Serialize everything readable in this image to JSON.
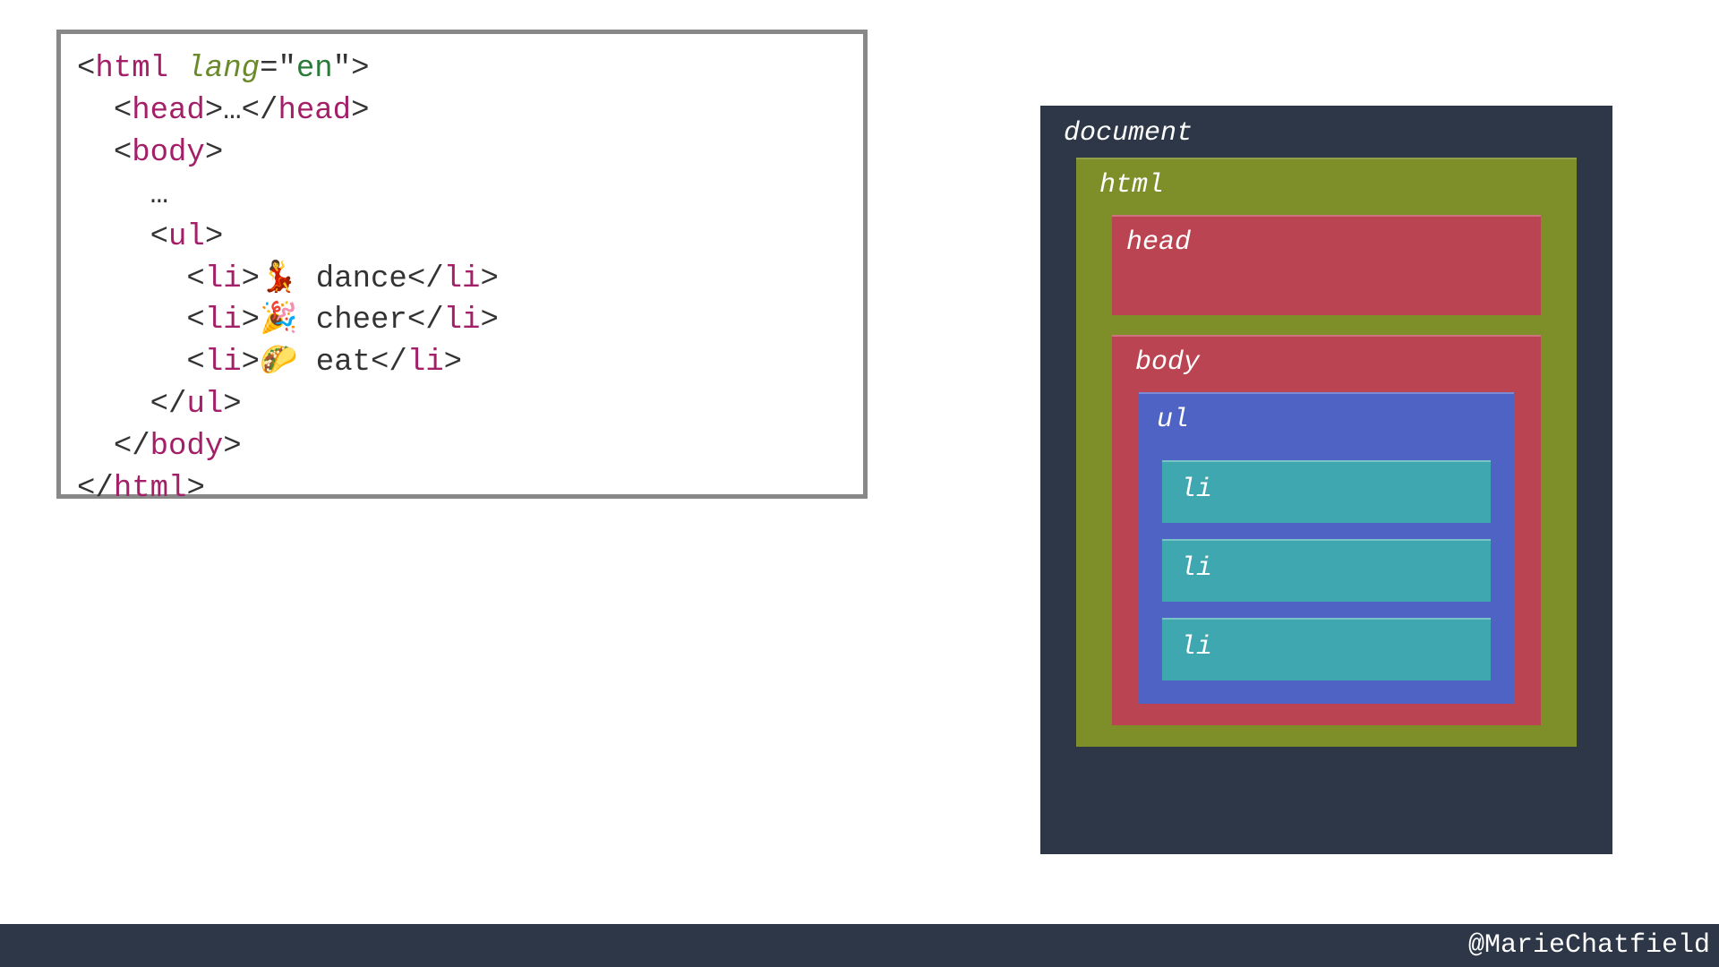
{
  "code": {
    "lines": [
      {
        "indent": 0,
        "parts": [
          {
            "t": "punct",
            "v": "<"
          },
          {
            "t": "tag",
            "v": "html"
          },
          {
            "t": "text",
            "v": " "
          },
          {
            "t": "attr",
            "v": "lang"
          },
          {
            "t": "punct",
            "v": "="
          },
          {
            "t": "punct",
            "v": "\""
          },
          {
            "t": "val",
            "v": "en"
          },
          {
            "t": "punct",
            "v": "\""
          },
          {
            "t": "punct",
            "v": ">"
          }
        ]
      },
      {
        "indent": 1,
        "parts": [
          {
            "t": "punct",
            "v": "<"
          },
          {
            "t": "tag",
            "v": "head"
          },
          {
            "t": "punct",
            "v": ">"
          },
          {
            "t": "text",
            "v": "…"
          },
          {
            "t": "punct",
            "v": "</"
          },
          {
            "t": "tag",
            "v": "head"
          },
          {
            "t": "punct",
            "v": ">"
          }
        ]
      },
      {
        "indent": 1,
        "parts": [
          {
            "t": "punct",
            "v": "<"
          },
          {
            "t": "tag",
            "v": "body"
          },
          {
            "t": "punct",
            "v": ">"
          }
        ]
      },
      {
        "indent": 2,
        "parts": [
          {
            "t": "text",
            "v": "…"
          }
        ]
      },
      {
        "indent": 2,
        "parts": [
          {
            "t": "punct",
            "v": "<"
          },
          {
            "t": "tag",
            "v": "ul"
          },
          {
            "t": "punct",
            "v": ">"
          }
        ]
      },
      {
        "indent": 3,
        "parts": [
          {
            "t": "punct",
            "v": "<"
          },
          {
            "t": "tag",
            "v": "li"
          },
          {
            "t": "punct",
            "v": ">"
          },
          {
            "t": "text",
            "v": "💃 dance"
          },
          {
            "t": "punct",
            "v": "</"
          },
          {
            "t": "tag",
            "v": "li"
          },
          {
            "t": "punct",
            "v": ">"
          }
        ]
      },
      {
        "indent": 3,
        "parts": [
          {
            "t": "punct",
            "v": "<"
          },
          {
            "t": "tag",
            "v": "li"
          },
          {
            "t": "punct",
            "v": ">"
          },
          {
            "t": "text",
            "v": "🎉 cheer"
          },
          {
            "t": "punct",
            "v": "</"
          },
          {
            "t": "tag",
            "v": "li"
          },
          {
            "t": "punct",
            "v": ">"
          }
        ]
      },
      {
        "indent": 3,
        "parts": [
          {
            "t": "punct",
            "v": "<"
          },
          {
            "t": "tag",
            "v": "li"
          },
          {
            "t": "punct",
            "v": ">"
          },
          {
            "t": "text",
            "v": "🌮 eat"
          },
          {
            "t": "punct",
            "v": "</"
          },
          {
            "t": "tag",
            "v": "li"
          },
          {
            "t": "punct",
            "v": ">"
          }
        ]
      },
      {
        "indent": 2,
        "parts": [
          {
            "t": "punct",
            "v": "</"
          },
          {
            "t": "tag",
            "v": "ul"
          },
          {
            "t": "punct",
            "v": ">"
          }
        ]
      },
      {
        "indent": 1,
        "parts": [
          {
            "t": "punct",
            "v": "</"
          },
          {
            "t": "tag",
            "v": "body"
          },
          {
            "t": "punct",
            "v": ">"
          }
        ]
      },
      {
        "indent": 0,
        "parts": [
          {
            "t": "punct",
            "v": "</"
          },
          {
            "t": "tag",
            "v": "html"
          },
          {
            "t": "punct",
            "v": ">"
          }
        ]
      }
    ]
  },
  "dom": {
    "document": "document",
    "html": "html",
    "head": "head",
    "body": "body",
    "ul": "ul",
    "li": [
      "li",
      "li",
      "li"
    ]
  },
  "footer": {
    "handle": "@MarieChatfield"
  },
  "colors": {
    "slide_bg": "#ffffff",
    "code_border": "#888888",
    "tag": "#a31f68",
    "attr": "#6a8a2b",
    "val": "#2a7a3a",
    "dark": "#2d3747",
    "olive": "#7e8f2a",
    "red": "#bb4452",
    "blue": "#4f63c5",
    "teal": "#3fa7b0"
  }
}
